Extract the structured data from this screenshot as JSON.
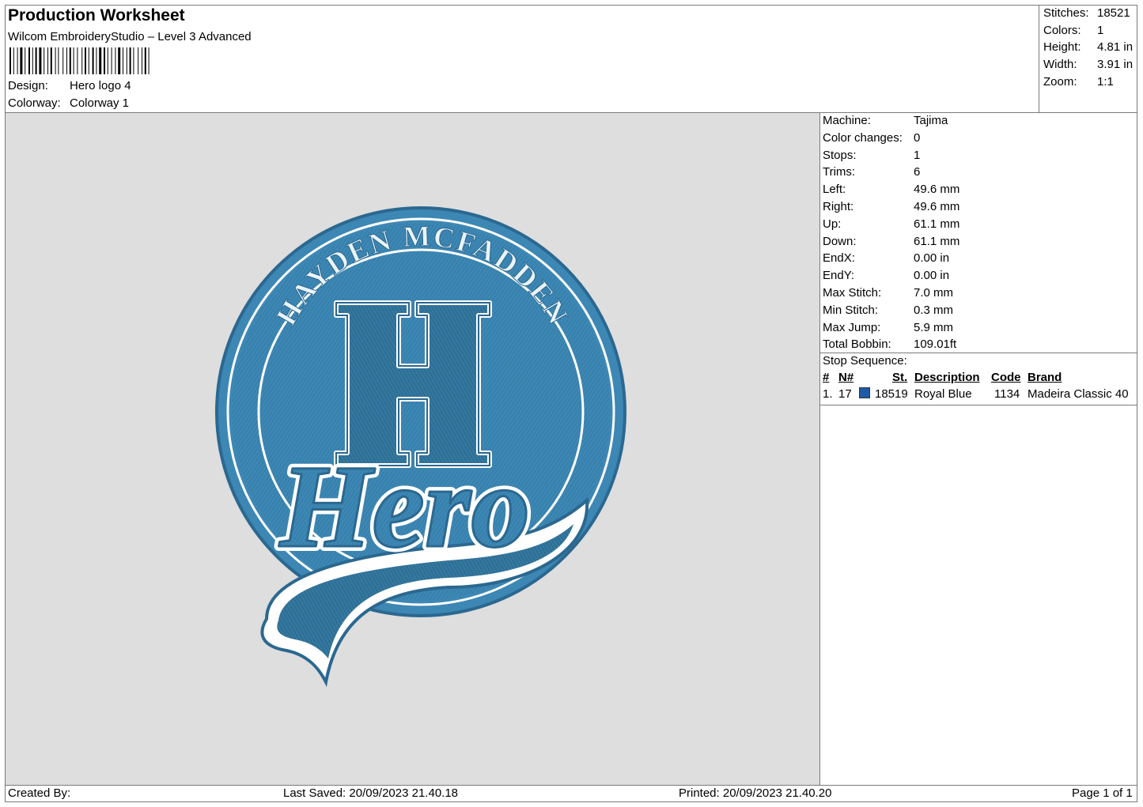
{
  "header": {
    "title": "Production Worksheet",
    "software": "Wilcom EmbroideryStudio – Level 3 Advanced",
    "design_label": "Design:",
    "design_value": "Hero logo 4",
    "colorway_label": "Colorway:",
    "colorway_value": "Colorway 1"
  },
  "summary": {
    "stitches_label": "Stitches:",
    "stitches": "18521",
    "colors_label": "Colors:",
    "colors": "1",
    "height_label": "Height:",
    "height": "4.81 in",
    "width_label": "Width:",
    "width": "3.91 in",
    "zoom_label": "Zoom:",
    "zoom": "1:1"
  },
  "machine_info": [
    {
      "label": "Machine:",
      "value": "Tajima"
    },
    {
      "label": "Color changes:",
      "value": "0"
    },
    {
      "label": "Stops:",
      "value": "1"
    },
    {
      "label": "Trims:",
      "value": "6"
    },
    {
      "label": "Left:",
      "value": "49.6 mm"
    },
    {
      "label": "Right:",
      "value": "49.6 mm"
    },
    {
      "label": "Up:",
      "value": "61.1 mm"
    },
    {
      "label": "Down:",
      "value": "61.1 mm"
    },
    {
      "label": "EndX:",
      "value": "0.00 in"
    },
    {
      "label": "EndY:",
      "value": "0.00 in"
    },
    {
      "label": "Max Stitch:",
      "value": "7.0 mm"
    },
    {
      "label": "Min Stitch:",
      "value": "0.3 mm"
    },
    {
      "label": "Max Jump:",
      "value": "5.9 mm"
    },
    {
      "label": "Total Bobbin:",
      "value": "109.01ft"
    }
  ],
  "stop_sequence": {
    "title": "Stop Sequence:",
    "headers": {
      "num": "#",
      "needle": "N#",
      "stitches": "St.",
      "description": "Description",
      "code": "Code",
      "brand": "Brand"
    },
    "rows": [
      {
        "num": "1.",
        "needle": "17",
        "color": "#1f5aa6",
        "stitches": "18519",
        "description": "Royal Blue",
        "code": "1134",
        "brand": "Madeira Classic 40"
      }
    ]
  },
  "design_preview": {
    "top_text": "HAYDEN MCFADDEN",
    "letter": "H",
    "script_text": "Hero",
    "thread_color": "#3d87b4",
    "dark_color": "#2b6890",
    "background": "#dedede"
  },
  "footer": {
    "created_by": "Created By:",
    "last_saved": "Last Saved: 20/09/2023 21.40.18",
    "printed": "Printed: 20/09/2023 21.40.20",
    "page": "Page 1 of 1"
  }
}
